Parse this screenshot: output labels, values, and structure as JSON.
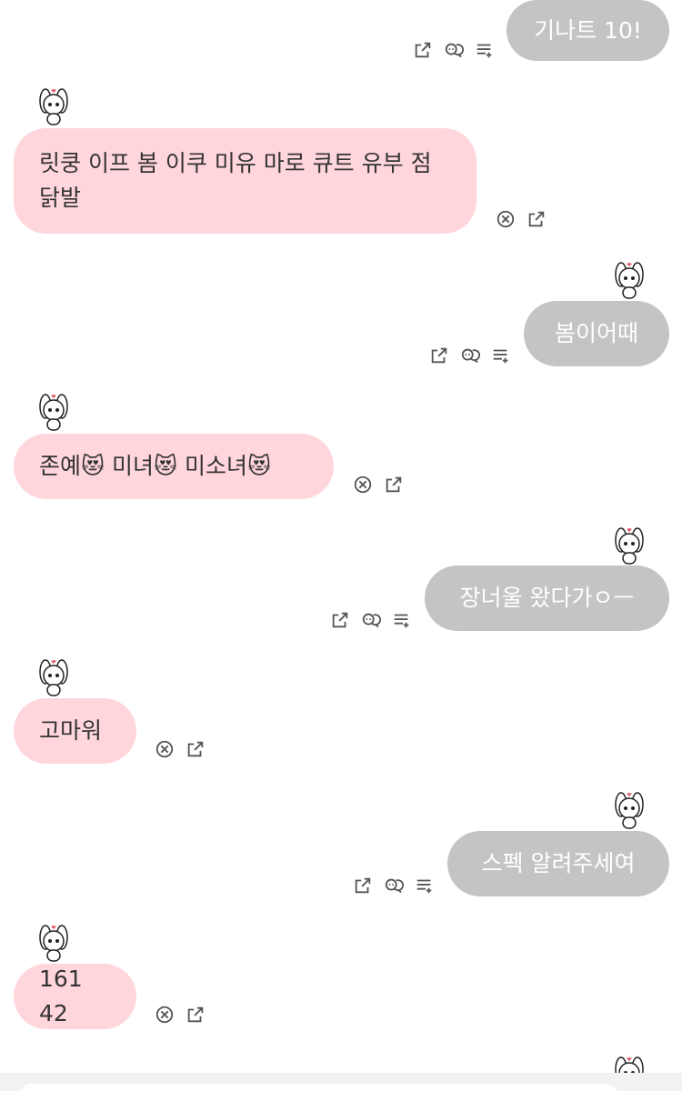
{
  "chat": {
    "messages": [
      {
        "sender": "me",
        "text": "기나트 10!"
      },
      {
        "sender": "bot",
        "text": "릿쿵 이프 봄 이쿠 미유 마로 큐트 유부 점 닭발"
      },
      {
        "sender": "me",
        "text": "봄이어때"
      },
      {
        "sender": "bot",
        "text": "존예😻 미녀😻 미소녀😻"
      },
      {
        "sender": "me",
        "text": "장너울 왔다가ㅇㅡ"
      },
      {
        "sender": "bot",
        "text": "고마워"
      },
      {
        "sender": "me",
        "text": "스펙 알려주세여"
      },
      {
        "sender": "bot",
        "text": "161 42"
      }
    ]
  },
  "icons": {
    "user_actions": [
      "share-icon",
      "comment-icon",
      "add-to-list-icon"
    ],
    "bot_actions": [
      "close-circle-icon",
      "share-icon"
    ],
    "avatar": "white-bunny-character-icon"
  },
  "colors": {
    "user_bubble": "#c4c4c4",
    "bot_bubble": "#ffd6dc",
    "icon": "#555555",
    "background": "#ffffff"
  }
}
